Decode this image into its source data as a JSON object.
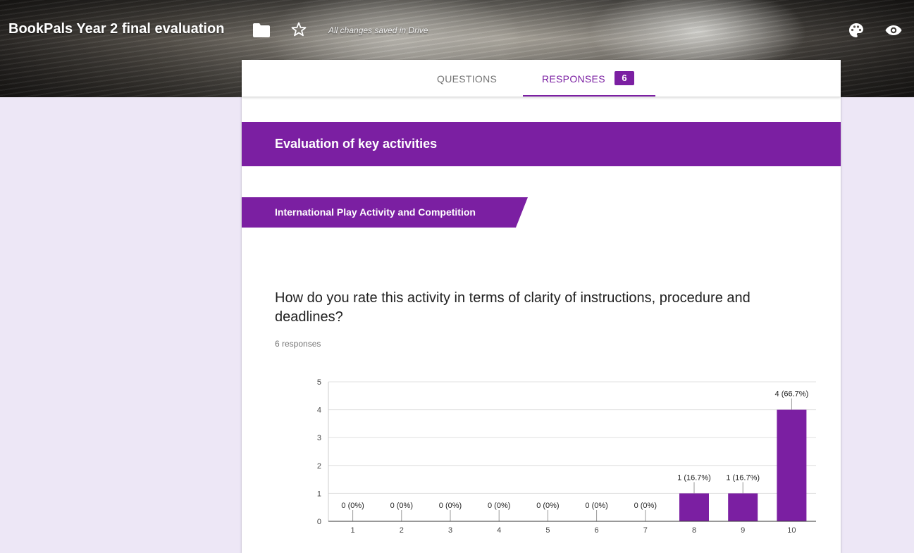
{
  "header": {
    "title": "BookPals Year 2 final evaluation",
    "status": "All changes saved in Drive",
    "icons": [
      "folder-icon",
      "star-icon",
      "palette-icon",
      "eye-icon"
    ]
  },
  "tabs": {
    "questions_label": "QUESTIONS",
    "responses_label": "RESPONSES",
    "responses_count": "6"
  },
  "section": {
    "title": "Evaluation of key activities",
    "subsection": "International Play Activity and Competition"
  },
  "question": {
    "text": "How do you rate this activity in terms of clarity of instructions, procedure and deadlines?",
    "responses": "6 responses"
  },
  "colors": {
    "accent": "#7b1fa2",
    "page_background": "#ede7f6"
  },
  "chart_data": {
    "type": "bar",
    "categories": [
      "1",
      "2",
      "3",
      "4",
      "5",
      "6",
      "7",
      "8",
      "9",
      "10"
    ],
    "values": [
      0,
      0,
      0,
      0,
      0,
      0,
      0,
      1,
      1,
      4
    ],
    "labels": [
      "0 (0%)",
      "0 (0%)",
      "0 (0%)",
      "0 (0%)",
      "0 (0%)",
      "0 (0%)",
      "0 (0%)",
      "1 (16.7%)",
      "1 (16.7%)",
      "4 (66.7%)"
    ],
    "yticks": [
      "0",
      "1",
      "2",
      "3",
      "4",
      "5"
    ],
    "ylim": [
      0,
      5
    ],
    "grid": true,
    "bar_color": "#7b1fa2"
  }
}
